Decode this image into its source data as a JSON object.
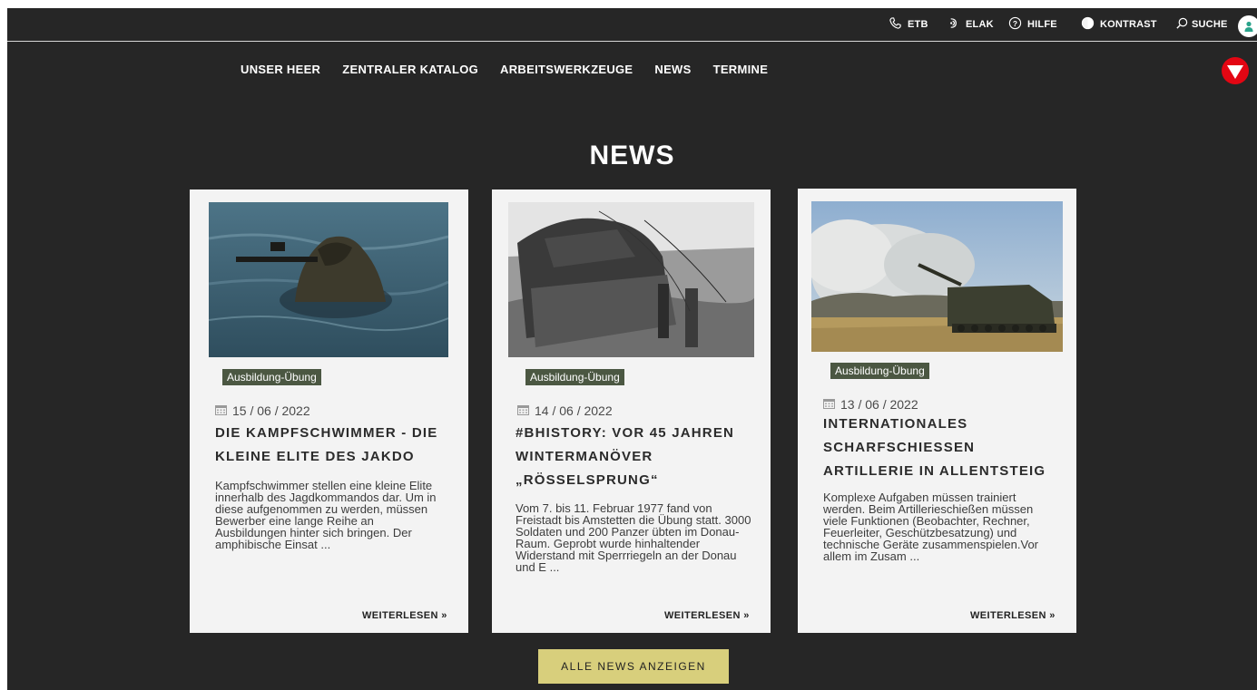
{
  "utility": {
    "items": [
      {
        "label": "ETB",
        "icon": "phone-icon"
      },
      {
        "label": "ELAK",
        "icon": "elak-icon"
      },
      {
        "label": "HILFE",
        "icon": "help-icon"
      },
      {
        "label": "KONTRAST",
        "icon": "contrast-icon"
      },
      {
        "label": "SUCHE",
        "icon": "search-icon"
      }
    ]
  },
  "nav": {
    "items": [
      "UNSER HEER",
      "ZENTRALER KATALOG",
      "ARBEITSWERKZEUGE",
      "NEWS",
      "TERMINE"
    ]
  },
  "section": {
    "title": "NEWS"
  },
  "cards": [
    {
      "tag": "Ausbildung-Übung",
      "date": "15 / 06 / 2022",
      "headline": "DIE KAMPFSCHWIMMER - DIE KLEINE ELITE DES JAKDO",
      "excerpt": "Kampfschwimmer stellen eine kleine Elite innerhalb des Jagdkommandos dar. Um in diese aufgenommen zu werden, müssen Bewerber eine lange Reihe an Ausbildungen hinter sich bringen. Der amphibische Einsat ...",
      "more": "WEITERLESEN »"
    },
    {
      "tag": "Ausbildung-Übung",
      "date": "14 / 06 / 2022",
      "headline": "#BHISTORY: VOR 45 JAHREN WINTERMANÖVER „RÖSSELSPRUNG“",
      "excerpt": "Vom 7. bis 11. Februar 1977 fand von Freistadt bis Amstetten die Übung statt. 3000 Soldaten und 200 Panzer übten im Donau-Raum. Geprobt wurde hinhaltender Widerstand mit Sperrriegeln an der Donau und E ...",
      "more": "WEITERLESEN »"
    },
    {
      "tag": "Ausbildung-Übung",
      "date": "13 / 06 / 2022",
      "headline": "INTERNATIONALES SCHARFSCHIESSEN ARTILLERIE IN ALLENTSTEIG",
      "excerpt": "Komplexe Aufgaben müssen trainiert werden. Beim Artillerieschießen müssen viele Funktionen (Beobachter, Rechner, Feuerleiter, Geschützbesatzung) und technische Geräte zusammenspielen.Vor allem im Zusam ...",
      "more": "WEITERLESEN »"
    }
  ],
  "all_news_label": "ALLE NEWS ANZEIGEN",
  "colors": {
    "background": "#262626",
    "card": "#f3f3f3",
    "tag": "#4b5742",
    "button": "#d8cf7c",
    "logo_red": "#e30613"
  }
}
